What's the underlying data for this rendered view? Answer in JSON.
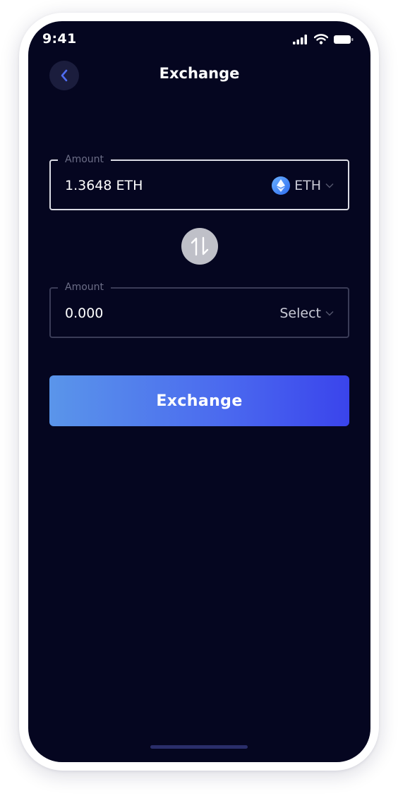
{
  "status_bar": {
    "time": "9:41",
    "icons": [
      "signal-icon",
      "wifi-icon",
      "battery-icon"
    ]
  },
  "header": {
    "title": "Exchange",
    "back_icon": "chevron-left-icon"
  },
  "from_field": {
    "label": "Amount",
    "value": "1.3648 ETH",
    "currency": "ETH",
    "currency_icon": "ethereum-icon"
  },
  "swap": {
    "icon": "swap-vertical-icon"
  },
  "to_field": {
    "label": "Amount",
    "value": "0.000",
    "currency": "Select"
  },
  "action": {
    "label": "Exchange"
  },
  "colors": {
    "background": "#050620",
    "accent_start": "#5a95ea",
    "accent_end": "#3a44ec",
    "back_chevron": "#4f6cf0"
  }
}
